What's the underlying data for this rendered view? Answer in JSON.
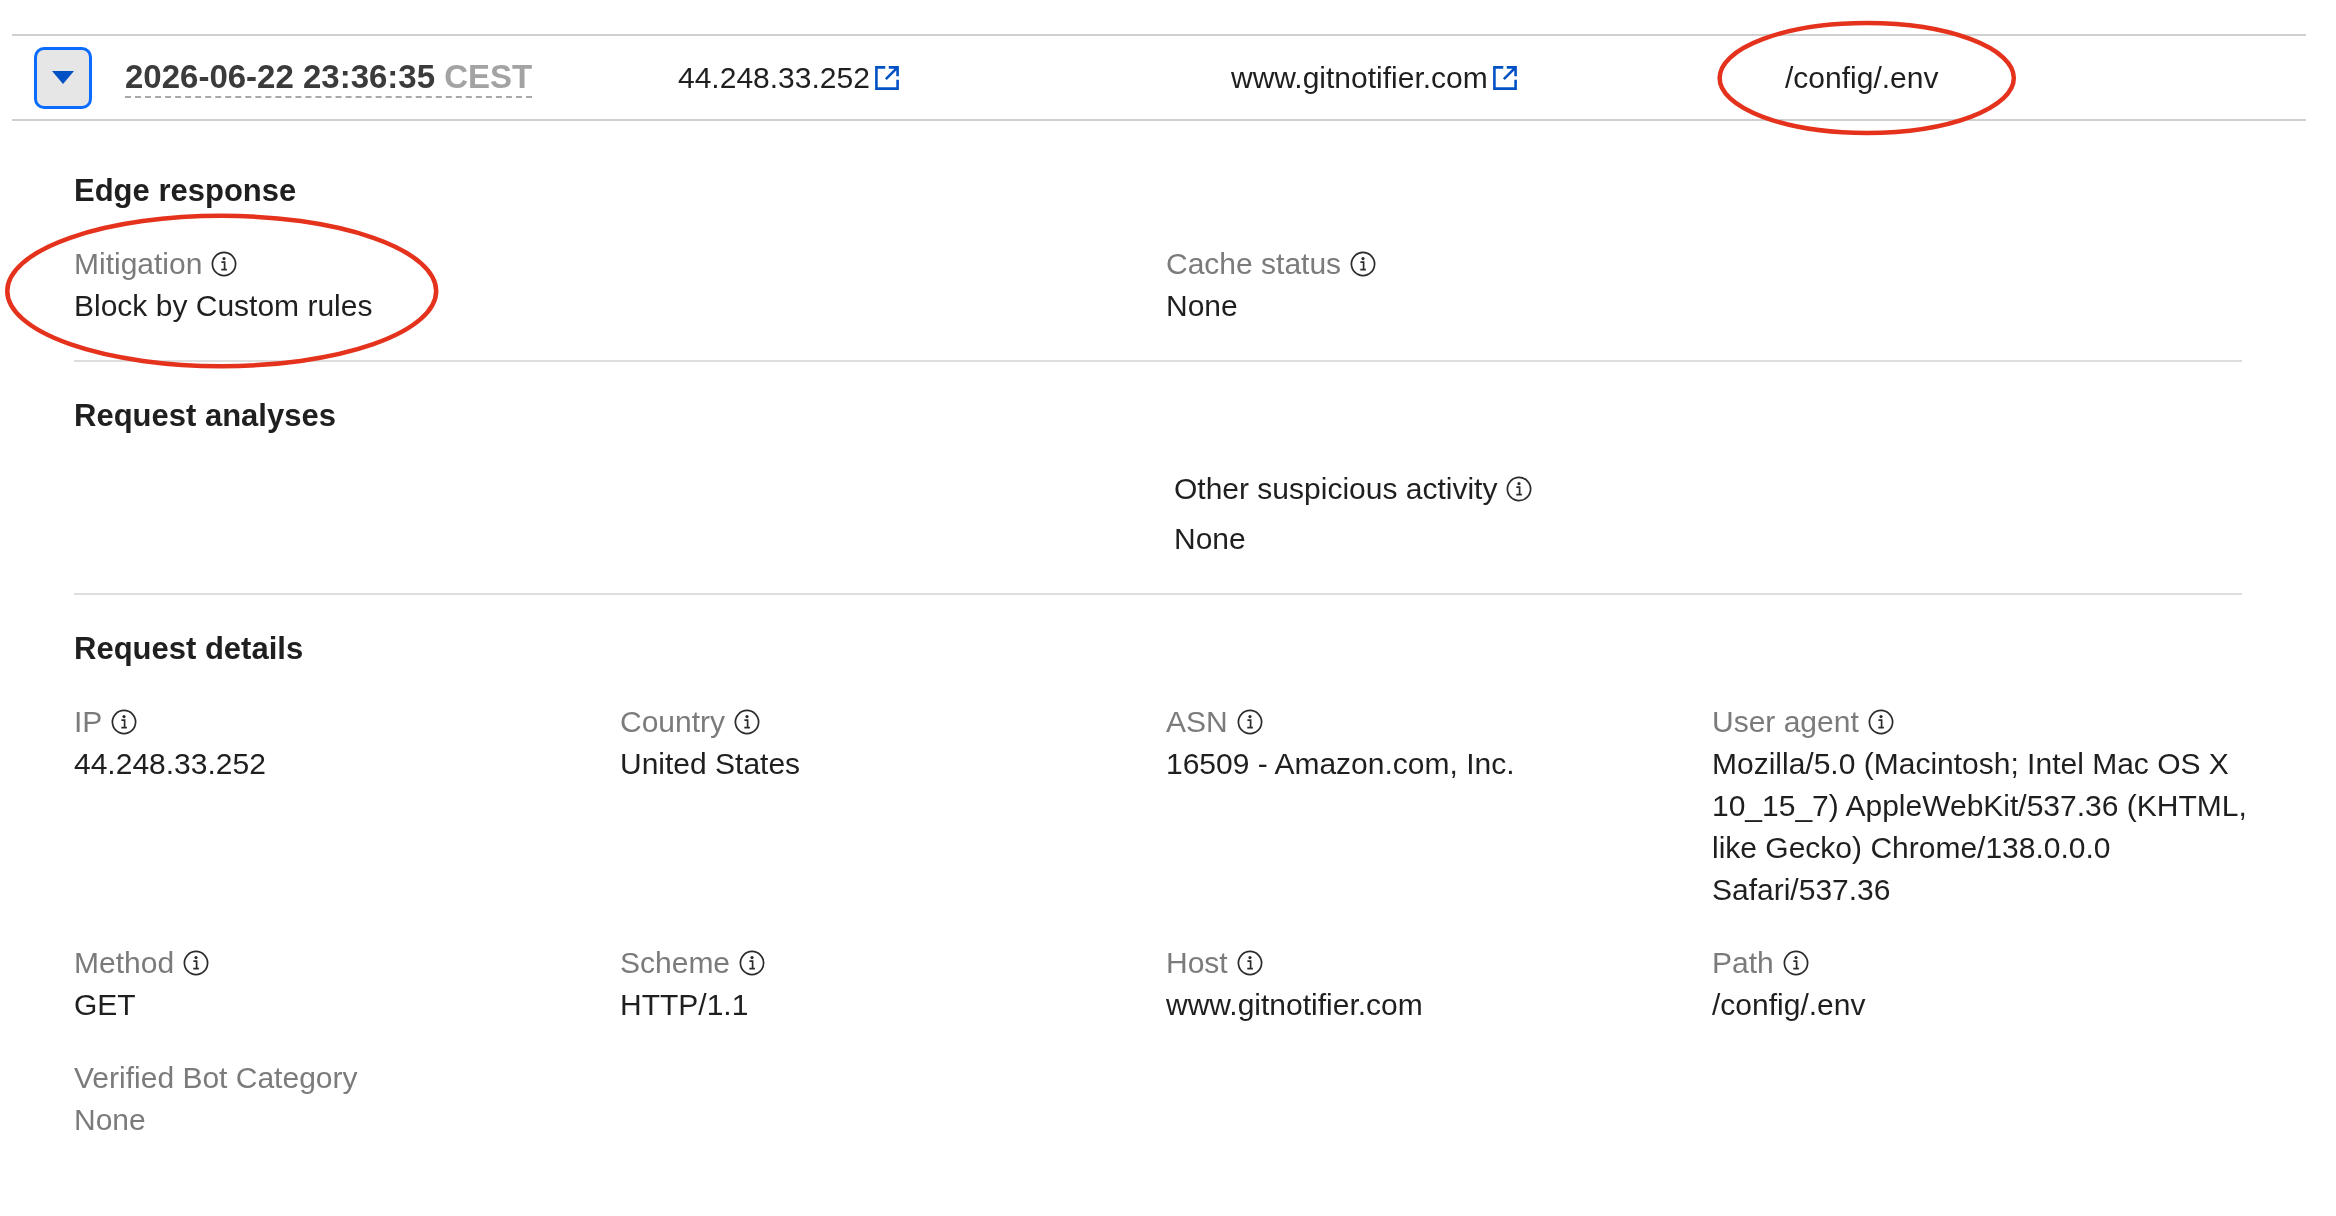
{
  "events": [
    {
      "expanded": true,
      "timestamp": "2026-06-22 23:36:35",
      "timezone": "CEST",
      "ip": "44.248.33.252",
      "host": "www.gitnotifier.com",
      "path": "/config/.env",
      "path_circled": true
    }
  ],
  "sections": [
    {
      "kind": "pairs",
      "title": "Edge response",
      "fields": [
        {
          "label": "Mitigation",
          "info": true,
          "value": "Block by Custom rules",
          "muted": false,
          "circled": true
        },
        {
          "label": "Cache status",
          "info": true,
          "value": "None",
          "muted": false,
          "circled": false
        }
      ]
    },
    {
      "kind": "analyses",
      "title": "Request analyses",
      "fields": [
        {
          "label": "Other suspicious activity",
          "info": true,
          "value": "None",
          "muted": false,
          "circled": false
        }
      ]
    },
    {
      "kind": "details",
      "title": "Request details",
      "fields": [
        {
          "label": "IP",
          "info": true,
          "value": "44.248.33.252",
          "muted": false,
          "circled": false
        },
        {
          "label": "Country",
          "info": true,
          "value": "United States",
          "muted": false,
          "circled": false
        },
        {
          "label": "ASN",
          "info": true,
          "value": "16509 - Amazon.com, Inc.",
          "muted": false,
          "circled": false
        },
        {
          "label": "User agent",
          "info": true,
          "value": "Mozilla/5.0 (Macintosh; Intel Mac OS X 10_15_7) AppleWebKit/537.36 (KHTML, like Gecko) Chrome/138.0.0.0 Safari/537.36",
          "muted": false,
          "circled": false
        },
        {
          "label": "Method",
          "info": true,
          "value": "GET",
          "muted": false,
          "circled": false
        },
        {
          "label": "Scheme",
          "info": true,
          "value": "HTTP/1.1",
          "muted": false,
          "circled": false
        },
        {
          "label": "Host",
          "info": true,
          "value": "www.gitnotifier.com",
          "muted": false,
          "circled": false
        },
        {
          "label": "Path",
          "info": true,
          "value": "/config/.env",
          "muted": false,
          "circled": false
        },
        {
          "label": "Verified Bot Category",
          "info": false,
          "value": "None",
          "muted": true,
          "circled": false
        }
      ]
    }
  ]
}
